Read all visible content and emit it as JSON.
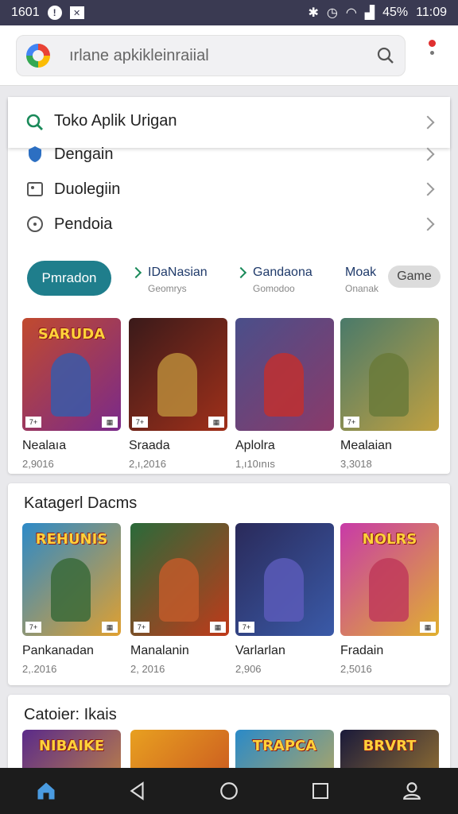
{
  "status_bar": {
    "left_time": "1601",
    "right_text": "45%",
    "clock": "11:09"
  },
  "search": {
    "text": "ırlane apkikleinraiial"
  },
  "suggestion": {
    "label": "Toko Aplik Urigan"
  },
  "list_items": [
    {
      "label": "Dengain",
      "icon": "shield-icon"
    },
    {
      "label": "Duolegiin",
      "icon": "image-icon"
    },
    {
      "label": "Pendoia",
      "icon": "clock-icon"
    }
  ],
  "chips": {
    "primary": "Pmradon",
    "items": [
      {
        "title": "IDaNasian",
        "sub": "Geomrys"
      },
      {
        "title": "Gandaona",
        "sub": "Gomodoo"
      },
      {
        "title": "Moak",
        "sub": "Onanak"
      }
    ],
    "game": "Game"
  },
  "featured_games": [
    {
      "banner": "SARUDA",
      "name": "Nealaıa",
      "count": "2,9016",
      "color": "#c14a2e",
      "fig": "#3a5aa8"
    },
    {
      "banner": "",
      "name": "Sraada",
      "count": "2,ı,2016",
      "color": "#3a1a1a",
      "fig": "#b88a3a"
    },
    {
      "banner": "",
      "name": "Aplolra",
      "count": "1,ı10ınıs",
      "color": "#4a4f8a",
      "fig": "#c03030"
    },
    {
      "banner": "",
      "name": "Mealaian",
      "count": "3,3018",
      "color": "#4a7a6a",
      "fig": "#6a7a3a"
    }
  ],
  "category1": {
    "title": "Katagerl Dacms",
    "games": [
      {
        "banner": "REHUNIS",
        "name": "Pankanadan",
        "count": "2,.2016",
        "color": "#2d8ac8",
        "fig": "#3a6a3a"
      },
      {
        "banner": "",
        "name": "Manalanin",
        "count": "2, 2016",
        "color": "#2a6a3a",
        "fig": "#c05a2a"
      },
      {
        "banner": "",
        "name": "Varlarlan",
        "count": "2,906",
        "color": "#2a2a5a",
        "fig": "#5a5ab8"
      },
      {
        "banner": "NOLRS",
        "name": "Fradain",
        "count": "2,5016",
        "color": "#c83aa8",
        "fig": "#c03a5a"
      }
    ]
  },
  "category2": {
    "title": "Catoier: Ikais",
    "games": [
      {
        "banner": "NIBAIKE",
        "color": "#5a2a8a"
      },
      {
        "banner": "",
        "color": "#e8a020"
      },
      {
        "banner": "TRAPCA",
        "color": "#2a8ac8"
      },
      {
        "banner": "BRVRT",
        "color": "#1a1a3a"
      }
    ]
  }
}
